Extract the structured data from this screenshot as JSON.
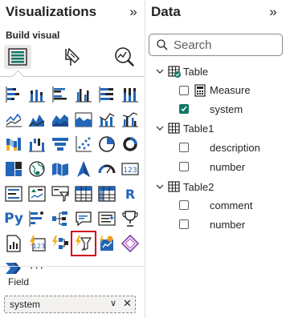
{
  "visualizations": {
    "title": "Visualizations",
    "collapse_glyph": "»",
    "build_visual_label": "Build visual",
    "modes": [
      "build-visual-icon",
      "format-visual-icon",
      "analytics-icon"
    ],
    "tiles": [
      "stacked-bar-chart-icon",
      "stacked-column-chart-icon",
      "clustered-bar-chart-icon",
      "clustered-column-chart-icon",
      "100-percent-stacked-bar-chart-icon",
      "100-percent-stacked-column-chart-icon",
      "line-chart-icon",
      "area-chart-icon",
      "stacked-area-chart-icon",
      "100-percent-stacked-area-chart-icon",
      "line-and-stacked-column-chart-icon",
      "line-and-clustered-column-chart-icon",
      "ribbon-chart-icon",
      "waterfall-chart-icon",
      "funnel-chart-icon",
      "scatter-chart-icon",
      "pie-chart-icon",
      "donut-chart-icon",
      "treemap-icon",
      "map-icon",
      "filled-map-icon",
      "azure-map-icon",
      "gauge-icon",
      "card-icon",
      "multi-row-card-icon",
      "kpi-icon",
      "slicer-icon",
      "table-icon",
      "matrix-icon",
      "r-visual-icon",
      "python-visual-icon",
      "key-influencers-icon",
      "decomposition-tree-icon",
      "qa-icon",
      "smart-narrative-icon",
      "metrics-icon",
      "paginated-report-icon",
      "power-apps-icon",
      "power-automate-icon",
      "custom-visual-icon",
      "custom-visual-2-icon",
      "get-more-visuals-icon",
      "power-automate-flow-icon",
      "more-options-icon"
    ],
    "selected_tile": "custom-visual-icon",
    "py_text": "Py",
    "r_text": "R",
    "more_text": "···",
    "field_label": "Field",
    "field_value": "system",
    "field_chevron": "∨",
    "field_remove": "✕"
  },
  "data_pane": {
    "title": "Data",
    "collapse_glyph": "»",
    "search_placeholder": "Search",
    "tables": [
      {
        "name": "Table",
        "fields": [
          {
            "name": "Measure",
            "checked": false,
            "type": "measure"
          },
          {
            "name": "system",
            "checked": true
          }
        ]
      },
      {
        "name": "Table1",
        "fields": [
          {
            "name": "description",
            "checked": false
          },
          {
            "name": "number",
            "checked": false
          }
        ]
      },
      {
        "name": "Table2",
        "fields": [
          {
            "name": "comment",
            "checked": false
          },
          {
            "name": "number",
            "checked": false
          }
        ]
      }
    ]
  },
  "colors": {
    "accent_green": "#117865",
    "selection_red": "#d0021b",
    "icon_blue": "#2266b8",
    "icon_yellow": "#f2b01e"
  }
}
